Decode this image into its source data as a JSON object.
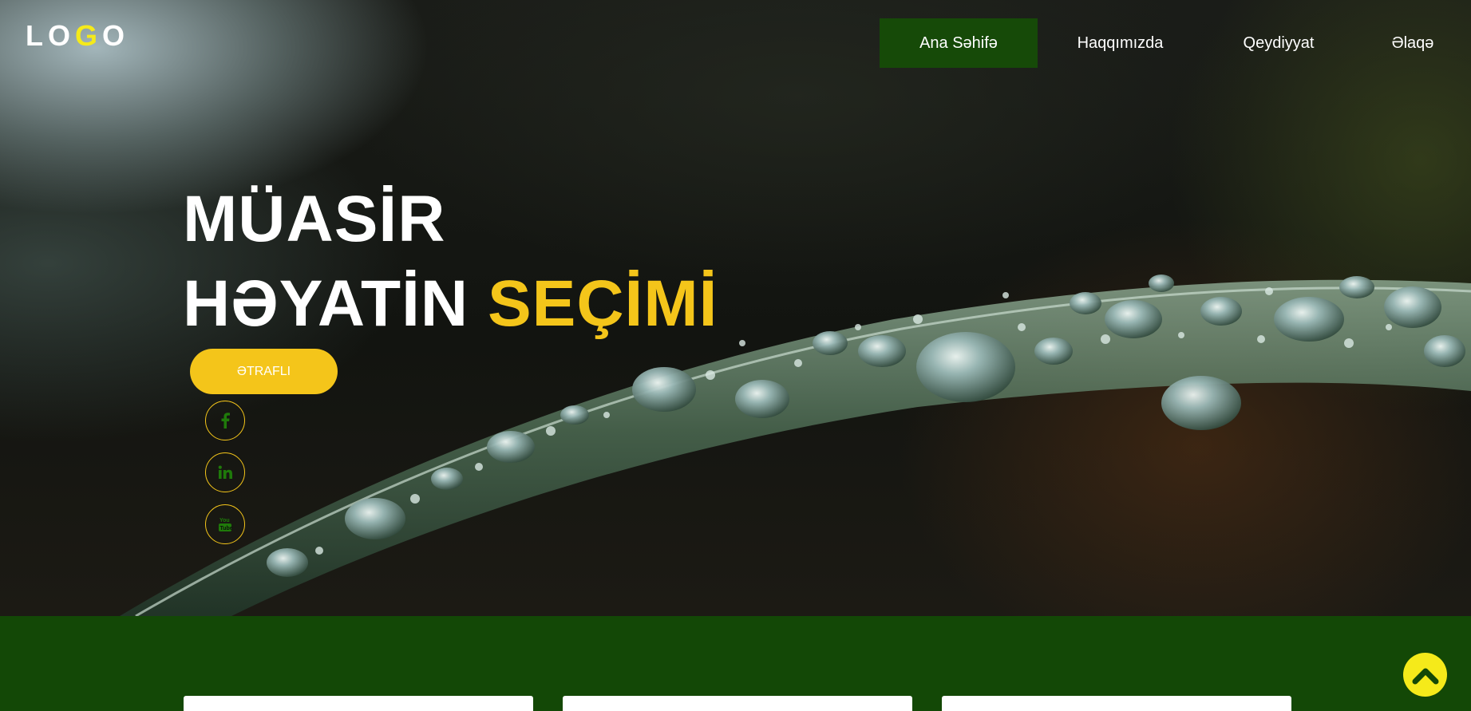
{
  "logo": {
    "part1": "LO",
    "part2": "G",
    "part3": "O"
  },
  "nav": {
    "items": [
      {
        "label": "Ana Səhifə",
        "active": true
      },
      {
        "label": "Haqqımızda",
        "active": false
      },
      {
        "label": "Qeydiyyat",
        "active": false
      },
      {
        "label": "Əlaqə",
        "active": false
      }
    ]
  },
  "hero": {
    "line1": "MÜASİR",
    "line2_white": "HƏYATİN",
    "line2_yellow": "SEÇİMİ",
    "button_label": "ƏTRAFLI"
  },
  "social": {
    "icons": [
      "facebook-icon",
      "linkedin-icon",
      "youtube-icon"
    ]
  },
  "colors": {
    "brand_green": "#164a08",
    "band_green": "#134806",
    "accent_yellow": "#f4c51a",
    "logo_yellow": "#f5ea1a"
  },
  "scroll_top": {
    "icon": "chevron-up-icon"
  }
}
